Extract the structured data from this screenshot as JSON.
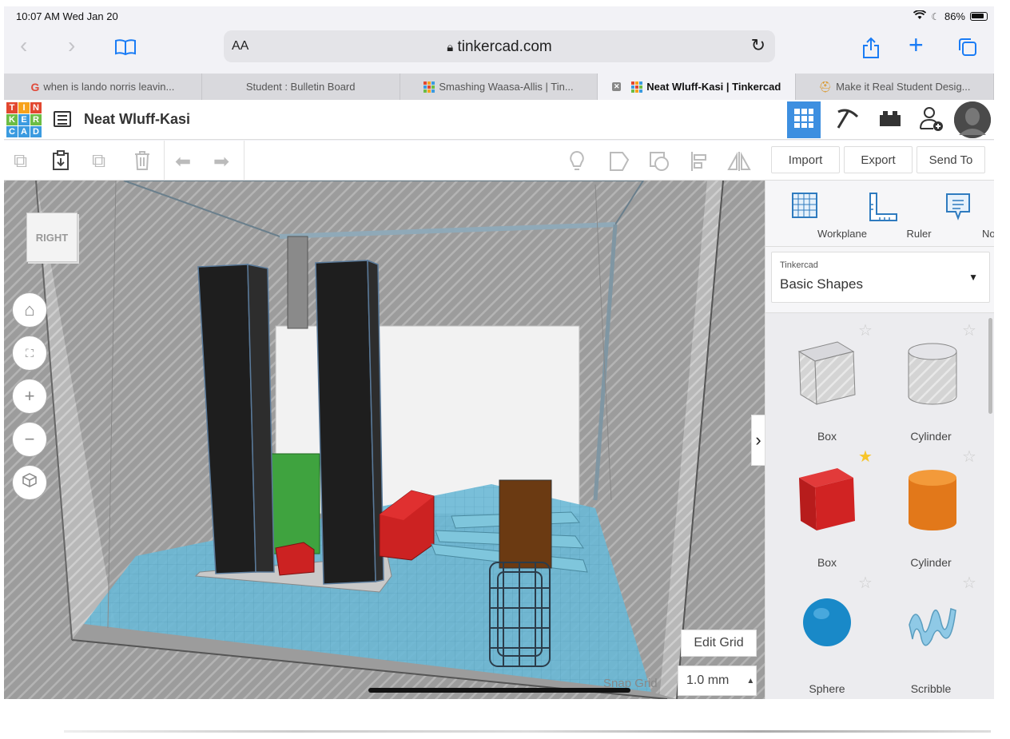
{
  "status": {
    "time": "10:07 AM  Wed Jan 20",
    "battery": "86%"
  },
  "browser": {
    "aa": "AA",
    "url": "tinkercad.com"
  },
  "tabs": [
    {
      "label": "when is lando norris leavin...",
      "icon": "google-icon"
    },
    {
      "label": "Student : Bulletin Board",
      "icon": ""
    },
    {
      "label": "Smashing Waasa-Allis | Tin...",
      "icon": "tinkercad-icon"
    },
    {
      "label": "Neat Wluff-Kasi | Tinkercad",
      "icon": "tinkercad-icon",
      "active": true
    },
    {
      "label": "Make it Real Student Desig...",
      "icon": "hardhat-icon"
    }
  ],
  "header": {
    "logo": [
      "T",
      "I",
      "N",
      "K",
      "E",
      "R",
      "C",
      "A",
      "D"
    ],
    "project_name": "Neat Wluff-Kasi",
    "active_view": "3d-design"
  },
  "toolbar": {
    "import": "Import",
    "export": "Export",
    "send_to": "Send To"
  },
  "viewport": {
    "viewcube": "RIGHT",
    "edit_grid": "Edit Grid",
    "snap_grid_label": "Snap Grid",
    "snap_grid_value": "1.0 mm"
  },
  "panel": {
    "tools": [
      "Workplane",
      "Ruler",
      "Notes"
    ],
    "library_category": "Tinkercad",
    "library_name": "Basic Shapes",
    "shapes": [
      {
        "label": "Box",
        "style": "hole",
        "favorite": false
      },
      {
        "label": "Cylinder",
        "style": "hole",
        "favorite": false
      },
      {
        "label": "Box",
        "style": "solid-red",
        "favorite": true
      },
      {
        "label": "Cylinder",
        "style": "solid-orange",
        "favorite": false
      },
      {
        "label": "Sphere",
        "style": "solid-blue",
        "favorite": false
      },
      {
        "label": "Scribble",
        "style": "solid-lightblue",
        "favorite": false
      }
    ]
  },
  "colors": {
    "accent": "#3d8fe0",
    "safari_blue": "#1a7cf5",
    "workplane": "#5ab4d6"
  }
}
